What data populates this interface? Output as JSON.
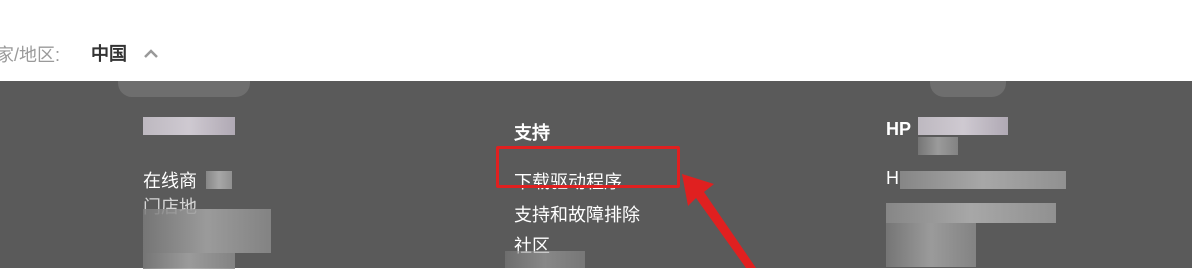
{
  "country_selector": {
    "label": "家/地区:",
    "value": "中国"
  },
  "footer": {
    "col_left": {
      "items": [
        "在线商",
        "门店地"
      ]
    },
    "col_support": {
      "title": "支持",
      "items": [
        "下载驱动程序",
        "支持和故障排除",
        "社区"
      ]
    },
    "col_hp": {
      "title": "HP",
      "items": [
        "H"
      ]
    }
  },
  "annotation": {
    "highlight_color": "#e02020"
  }
}
